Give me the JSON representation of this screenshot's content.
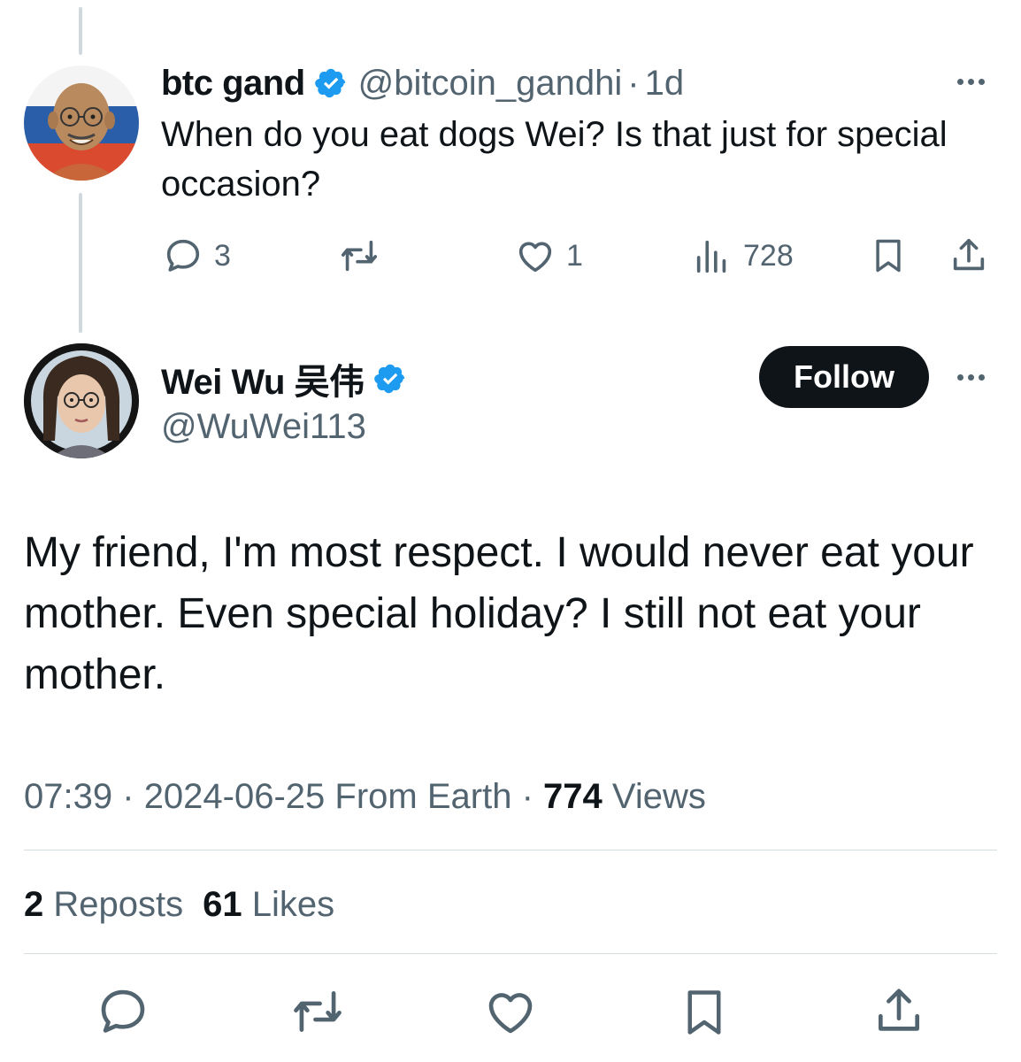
{
  "parent_tweet": {
    "display_name": "btc gand",
    "handle": "@bitcoin_gandhi",
    "separator": "·",
    "time_ago": "1d",
    "text": "When do you eat dogs Wei? Is that just for special occasion?",
    "replies": "3",
    "likes": "1",
    "views": "728"
  },
  "main_tweet": {
    "display_name": "Wei Wu 吴伟",
    "handle": "@WuWei113",
    "follow_label": "Follow",
    "text": "My friend, I'm most respect. I would never eat your mother. Even special holiday? I still not eat your mother.",
    "meta": {
      "time": "07:39",
      "sep1": "·",
      "date": "2024-06-25",
      "source": "From Earth",
      "sep2": "·",
      "views_count": "774",
      "views_label": "Views"
    },
    "stats": {
      "reposts_count": "2",
      "reposts_label": "Reposts",
      "likes_count": "61",
      "likes_label": "Likes"
    }
  },
  "colors": {
    "verified_blue": "#1d9bf0",
    "text_primary": "#0f1419",
    "text_secondary": "#536471",
    "follow_bg": "#0f1419"
  },
  "icons": {
    "verified": "verified-badge-icon",
    "more": "more-horizontal-icon",
    "reply": "reply-icon",
    "repost": "repost-icon",
    "like": "heart-icon",
    "views": "analytics-icon",
    "bookmark": "bookmark-icon",
    "share": "share-icon"
  }
}
